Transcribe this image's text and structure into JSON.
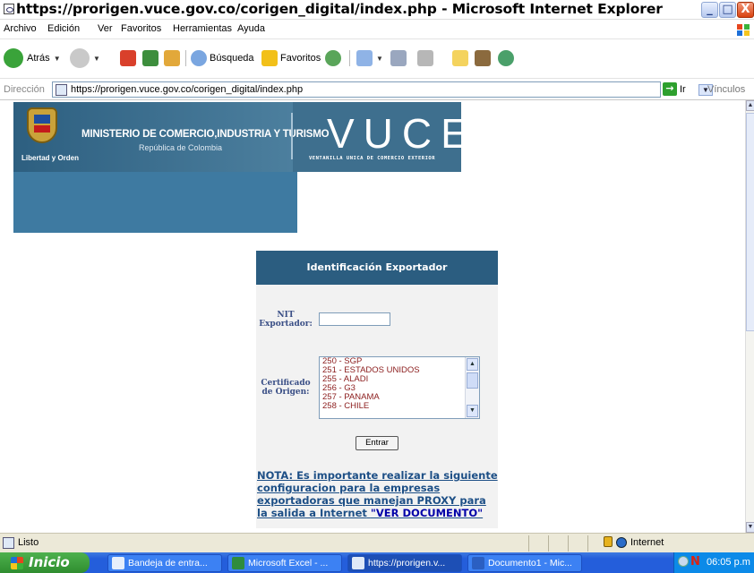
{
  "window": {
    "title": "https://prorigen.vuce.gov.co/corigen_digital/index.php - Microsoft Internet Explorer",
    "min_glyph": "_",
    "max_glyph": "□",
    "close_glyph": "X"
  },
  "menu": [
    "Archivo",
    "Edición",
    "Ver",
    "Favoritos",
    "Herramientas",
    "Ayuda"
  ],
  "toolbar": {
    "back_label": "Atrás",
    "search_label": "Búsqueda",
    "favorites_label": "Favoritos"
  },
  "address": {
    "label": "Dirección",
    "url": "https://prorigen.vuce.gov.co/corigen_digital/index.php",
    "go_label": "Ir",
    "links_label": "Vínculos"
  },
  "banner": {
    "motto": "Libertad y Orden",
    "ministry": "MINISTERIO DE COMERCIO,INDUSTRIA Y TURISMO",
    "republic": "República de Colombia",
    "logo": "VUCE",
    "logo_sub": "VENTANILLA UNICA DE COMERCIO EXTERIOR"
  },
  "form": {
    "heading": "Identificación Exportador",
    "nit_label": "NIT Exportador:",
    "nit_value": "",
    "cert_label": "Certificado de Origen:",
    "cert_options": [
      "250 - SGP",
      "251 - ESTADOS UNIDOS",
      "255 - ALADI",
      "256 - G3",
      "257 - PANAMA",
      "258 - CHILE"
    ],
    "submit_label": "Entrar"
  },
  "note": {
    "text": "NOTA: Es importante realizar la siguiente configuracion para la empresas exportadoras que manejan PROXY para la salida a Internet",
    "link": "\"VER DOCUMENTO\""
  },
  "status": {
    "text": "Listo",
    "zone": "Internet"
  },
  "taskbar": {
    "start_label": "Inicio",
    "tasks": [
      "Bandeja de entra...",
      "Microsoft Excel - ...",
      "https://prorigen.v...",
      "Documento1 - Mic..."
    ],
    "clock": "06:05 p.m"
  }
}
